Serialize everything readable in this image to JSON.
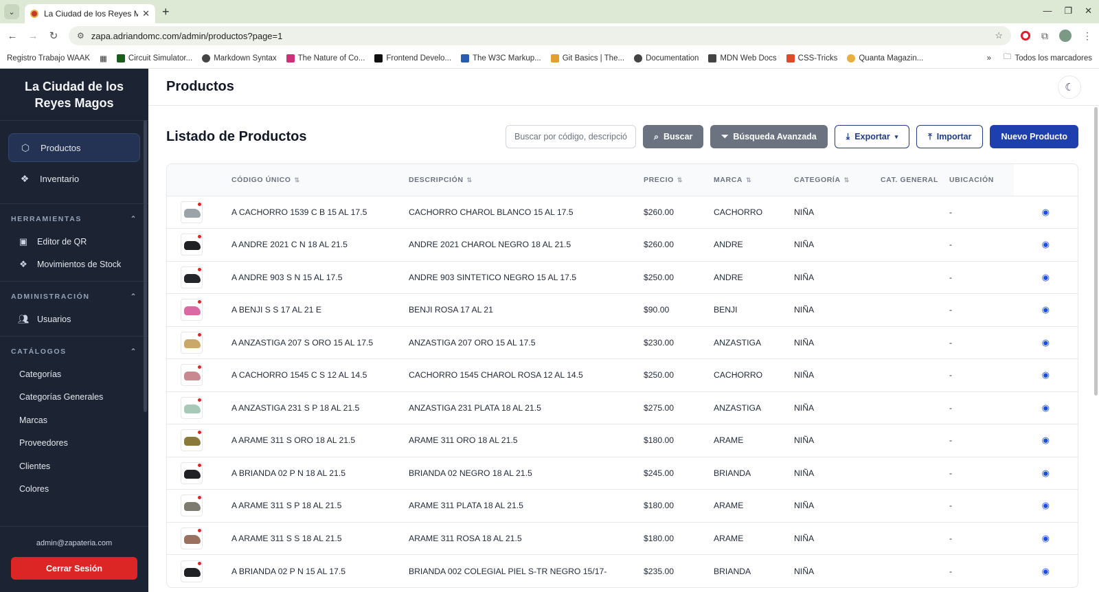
{
  "browser": {
    "tab_title": "La Ciudad de los Reyes Mag",
    "url": "zapa.adriandomc.com/admin/productos?page=1",
    "bookmarks": [
      "Registro Trabajo WAAK",
      "Circuit Simulator...",
      "Markdown Syntax",
      "The Nature of Co...",
      "Frontend Develo...",
      "The W3C Markup...",
      "Git Basics | The...",
      "Documentation",
      "MDN Web Docs",
      "CSS-Tricks",
      "Quanta Magazin..."
    ],
    "all_bookmarks": "Todos los marcadores"
  },
  "sidebar": {
    "brand": "La Ciudad de los Reyes Magos",
    "main_items": [
      {
        "label": "Productos",
        "icon": "cube-icon"
      },
      {
        "label": "Inventario",
        "icon": "boxes-icon"
      }
    ],
    "herramientas": {
      "title": "HERRAMIENTAS",
      "items": [
        {
          "label": "Editor de QR",
          "icon": "qr-icon"
        },
        {
          "label": "Movimientos de Stock",
          "icon": "boxes-icon"
        }
      ]
    },
    "administracion": {
      "title": "ADMINISTRACIÓN",
      "items": [
        {
          "label": "Usuarios",
          "icon": "users-icon"
        }
      ]
    },
    "catalogos": {
      "title": "CATÁLOGOS",
      "items": [
        "Categorías",
        "Categorías Generales",
        "Marcas",
        "Proveedores",
        "Clientes",
        "Colores"
      ]
    },
    "user_email": "admin@zapateria.com",
    "logout_label": "Cerrar Sesión"
  },
  "header": {
    "title": "Productos"
  },
  "list": {
    "title": "Listado de Productos",
    "search_placeholder": "Buscar por código, descripción",
    "search_label": "Buscar",
    "advanced_label": "Búsqueda Avanzada",
    "export_label": "Exportar",
    "import_label": "Importar",
    "new_label": "Nuevo Producto"
  },
  "table": {
    "columns": [
      "CÓDIGO ÚNICO",
      "DESCRIPCIÓN",
      "PRECIO",
      "MARCA",
      "CATEGORÍA",
      "CAT. GENERAL",
      "UBICACIÓN"
    ],
    "rows": [
      {
        "codigo": "A CACHORRO 1539 C B 15 AL 17.5",
        "descripcion": "CACHORRO CHAROL BLANCO 15 AL 17.5",
        "precio": "$260.00",
        "marca": "CACHORRO",
        "categoria": "NIÑA",
        "cat_general": "",
        "ubicacion": "-",
        "thumb_color": "#9aa3a8"
      },
      {
        "codigo": "A ANDRE 2021 C N 18 AL 21.5",
        "descripcion": "ANDRE 2021 CHAROL NEGRO 18 AL 21.5",
        "precio": "$260.00",
        "marca": "ANDRE",
        "categoria": "NIÑA",
        "cat_general": "",
        "ubicacion": "-",
        "thumb_color": "#1f2124"
      },
      {
        "codigo": "A ANDRE 903 S N 15 AL 17.5",
        "descripcion": "ANDRE 903 SINTETICO NEGRO 15 AL 17.5",
        "precio": "$250.00",
        "marca": "ANDRE",
        "categoria": "NIÑA",
        "cat_general": "",
        "ubicacion": "-",
        "thumb_color": "#23262b"
      },
      {
        "codigo": "A BENJI S S 17 AL 21 E",
        "descripcion": "BENJI ROSA 17 AL 21",
        "precio": "$90.00",
        "marca": "BENJI",
        "categoria": "NIÑA",
        "cat_general": "",
        "ubicacion": "-",
        "thumb_color": "#d96aa3"
      },
      {
        "codigo": "A ANZASTIGA 207 S ORO 15 AL 17.5",
        "descripcion": "ANZASTIGA 207 ORO 15 AL 17.5",
        "precio": "$230.00",
        "marca": "ANZASTIGA",
        "categoria": "NIÑA",
        "cat_general": "",
        "ubicacion": "-",
        "thumb_color": "#c9a86a"
      },
      {
        "codigo": "A CACHORRO 1545 C S 12 AL 14.5",
        "descripcion": "CACHORRO 1545 CHAROL ROSA 12 AL 14.5",
        "precio": "$250.00",
        "marca": "CACHORRO",
        "categoria": "NIÑA",
        "cat_general": "",
        "ubicacion": "-",
        "thumb_color": "#c9878f"
      },
      {
        "codigo": "A ANZASTIGA 231 S P 18 AL 21.5",
        "descripcion": "ANZASTIGA 231 PLATA 18 AL 21.5",
        "precio": "$275.00",
        "marca": "ANZASTIGA",
        "categoria": "NIÑA",
        "cat_general": "",
        "ubicacion": "-",
        "thumb_color": "#a8c8b8"
      },
      {
        "codigo": "A ARAME 311 S ORO 18 AL 21.5",
        "descripcion": "ARAME 311 ORO 18 AL 21.5",
        "precio": "$180.00",
        "marca": "ARAME",
        "categoria": "NIÑA",
        "cat_general": "",
        "ubicacion": "-",
        "thumb_color": "#8a7a3a"
      },
      {
        "codigo": "A BRIANDA 02 P N 18 AL 21.5",
        "descripcion": "BRIANDA 02 NEGRO 18 AL 21.5",
        "precio": "$245.00",
        "marca": "BRIANDA",
        "categoria": "NIÑA",
        "cat_general": "",
        "ubicacion": "-",
        "thumb_color": "#1f2124"
      },
      {
        "codigo": "A ARAME 311 S P 18 AL 21.5",
        "descripcion": "ARAME 311 PLATA 18 AL 21.5",
        "precio": "$180.00",
        "marca": "ARAME",
        "categoria": "NIÑA",
        "cat_general": "",
        "ubicacion": "-",
        "thumb_color": "#7d7a70"
      },
      {
        "codigo": "A ARAME 311 S S 18 AL 21.5",
        "descripcion": "ARAME 311 ROSA 18 AL 21.5",
        "precio": "$180.00",
        "marca": "ARAME",
        "categoria": "NIÑA",
        "cat_general": "",
        "ubicacion": "-",
        "thumb_color": "#9a7060"
      },
      {
        "codigo": "A BRIANDA 02 P N 15 AL 17.5",
        "descripcion": "BRIANDA 002 COLEGIAL PIEL S-TR NEGRO 15/17-",
        "precio": "$235.00",
        "marca": "BRIANDA",
        "categoria": "NIÑA",
        "cat_general": "",
        "ubicacion": "-",
        "thumb_color": "#1f2124"
      }
    ]
  },
  "colors": {
    "sidebar_bg": "#1c2434",
    "primary": "#1e40af",
    "danger": "#dc2626",
    "link": "#1d4ed8"
  }
}
